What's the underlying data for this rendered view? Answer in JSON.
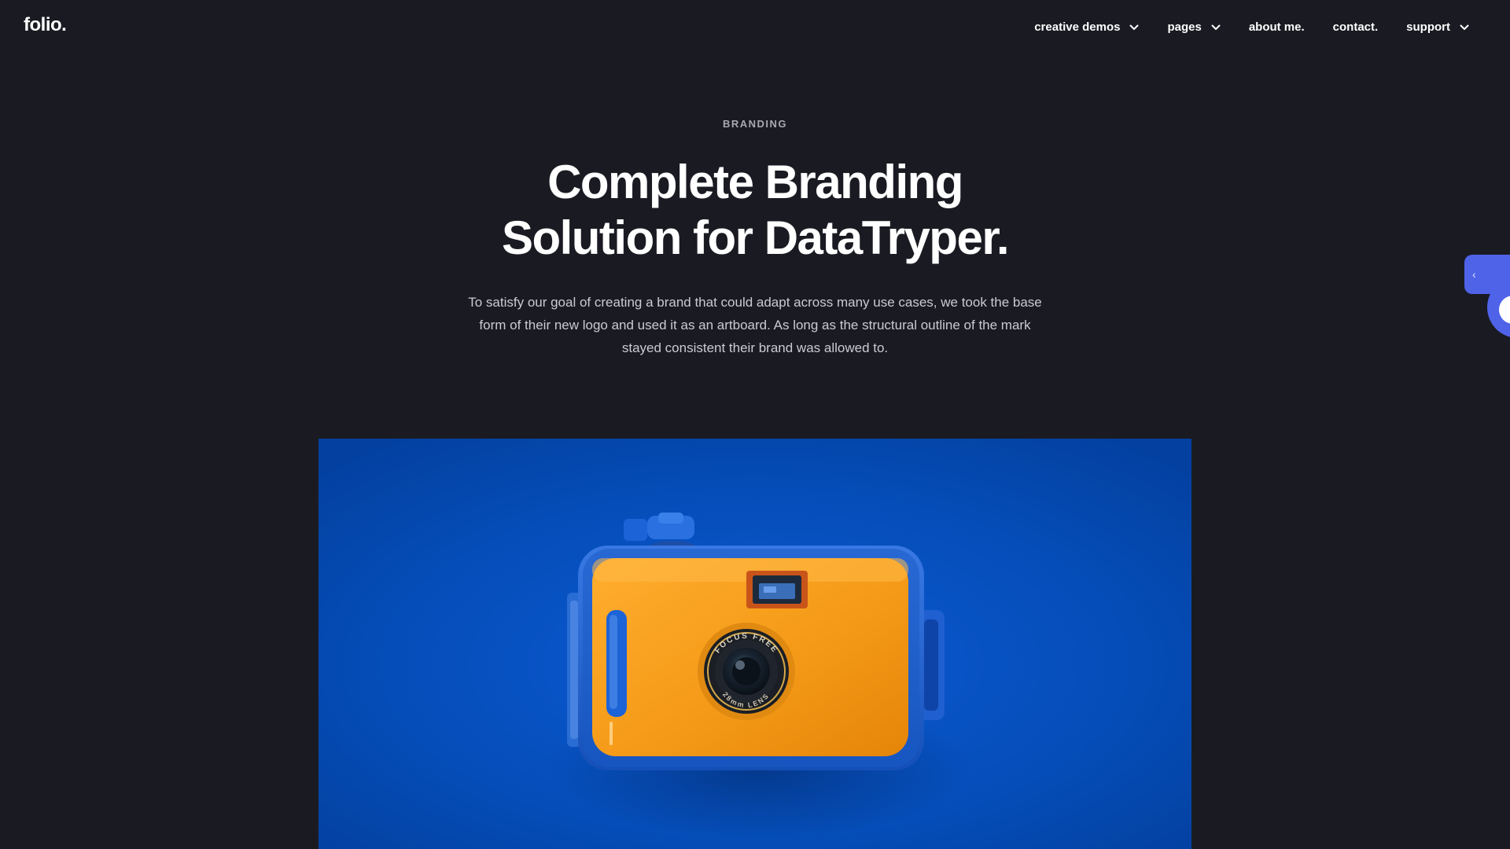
{
  "header": {
    "logo": "folio.",
    "nav": [
      {
        "label": "creative demos",
        "dropdown": true
      },
      {
        "label": "pages",
        "dropdown": true
      },
      {
        "label": "about me.",
        "dropdown": false
      },
      {
        "label": "contact.",
        "dropdown": false
      },
      {
        "label": "support",
        "dropdown": true
      }
    ]
  },
  "hero": {
    "eyebrow": "BRANDING",
    "title_line1": "Complete Branding",
    "title_line2": "Solution for DataTryper.",
    "description": "To satisfy our goal of creating a brand that could adapt across many use cases, we took the base form of their new logo and used it as an artboard. As long as the structural outline of the mark stayed consistent their brand was allowed to."
  },
  "side_widget": {
    "tab_glyph": "‹"
  },
  "image": {
    "subject": "orange waterproof camera on blue background",
    "lens_text_top": "FOCUS FREE",
    "lens_text_bottom": "28mm LENS"
  },
  "colors": {
    "background": "#1a1b22",
    "accent": "#4f63e9",
    "image_bg": "#0650c2",
    "camera_orange": "#f39a1c"
  }
}
